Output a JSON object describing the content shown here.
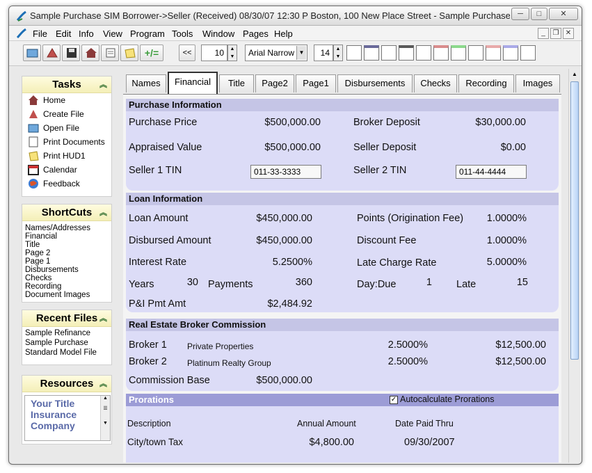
{
  "window": {
    "title": "Sample Purchase SIM Borrower->Seller (Received) 08/30/07 12:30 P Boston, 100 New Place Street - Sample Purchase SIM Borro...",
    "minimize": "─",
    "maximize": "□",
    "close": "✕"
  },
  "menu": {
    "items": [
      "File",
      "Edit",
      "Info",
      "View",
      "Program",
      "Tools",
      "Window",
      "Pages",
      "Help"
    ],
    "mdi_min": "_",
    "mdi_restore": "❐",
    "mdi_close": "✕"
  },
  "toolbar": {
    "back_label": "<<",
    "size_value": "10",
    "font_name": "Arial Narrow",
    "font_size": "14",
    "plus_equal": "+/="
  },
  "tasks": {
    "title": "Tasks",
    "items": [
      "Home",
      "Create File",
      "Open File",
      "Print Documents",
      "Print HUD1",
      "Calendar",
      "Feedback"
    ]
  },
  "shortcuts": {
    "title": "ShortCuts",
    "items": [
      "Names/Addresses",
      "Financial",
      "Title",
      "Page 2",
      "Page 1",
      "Disbursements",
      "Checks",
      "Recording",
      "Document Images"
    ]
  },
  "recent": {
    "title": "Recent Files",
    "items": [
      "Sample Refinance",
      "Sample Purchase",
      "Standard Model File"
    ]
  },
  "resources": {
    "title": "Resources",
    "line1": "Your Title",
    "line2": "Insurance",
    "line3": "Company"
  },
  "tabs": [
    "Names",
    "Financial",
    "Title",
    "Page2",
    "Page1",
    "Disbursements",
    "Checks",
    "Recording",
    "Images"
  ],
  "purchase": {
    "header": "Purchase Information",
    "purchase_price_label": "Purchase Price",
    "purchase_price": "$500,000.00",
    "broker_deposit_label": "Broker Deposit",
    "broker_deposit": "$30,000.00",
    "appraised_label": "Appraised Value",
    "appraised": "$500,000.00",
    "seller_deposit_label": "Seller Deposit",
    "seller_deposit": "$0.00",
    "seller1_tin_label": "Seller 1 TIN",
    "seller1_tin": "011-33-3333",
    "seller2_tin_label": "Seller 2 TIN",
    "seller2_tin": "011-44-4444"
  },
  "loan": {
    "header": "Loan Information",
    "loan_amount_label": "Loan Amount",
    "loan_amount": "$450,000.00",
    "points_label": "Points (Origination Fee)",
    "points": "1.0000%",
    "disbursed_label": "Disbursed Amount",
    "disbursed": "$450,000.00",
    "discount_label": "Discount Fee",
    "discount": "1.0000%",
    "rate_label": "Interest Rate",
    "rate": "5.2500%",
    "late_rate_label": "Late Charge Rate",
    "late_rate": "5.0000%",
    "years_label": "Years",
    "years": "30",
    "payments_label": "Payments",
    "payments": "360",
    "day_due_label": "Day:Due",
    "day_due": "1",
    "late_label": "Late",
    "late": "15",
    "pi_label": "P&I Pmt Amt",
    "pi": "$2,484.92"
  },
  "broker": {
    "header": "Real Estate Broker Commission",
    "broker1_label": "Broker 1",
    "broker1_name": "Private Properties",
    "broker1_pct": "2.5000%",
    "broker1_amt": "$12,500.00",
    "broker2_label": "Broker 2",
    "broker2_name": "Platinum Realty Group",
    "broker2_pct": "2.5000%",
    "broker2_amt": "$12,500.00",
    "base_label": "Commission Base",
    "base": "$500,000.00"
  },
  "prorations": {
    "header": "Prorations",
    "auto_label": "Autocalculate Prorations",
    "auto_checked": "✓",
    "col_description": "Description",
    "col_annual": "Annual Amount",
    "col_date": "Date Paid Thru",
    "row1_desc": "City/town Tax",
    "row1_amount": "$4,800.00",
    "row1_date": "09/30/2007"
  },
  "colors": {
    "section_bg": "#dcdcf7",
    "section_header": "#c5c5e6",
    "prorations_header": "#9c9cd6",
    "pane_header": "#f4efb8"
  }
}
